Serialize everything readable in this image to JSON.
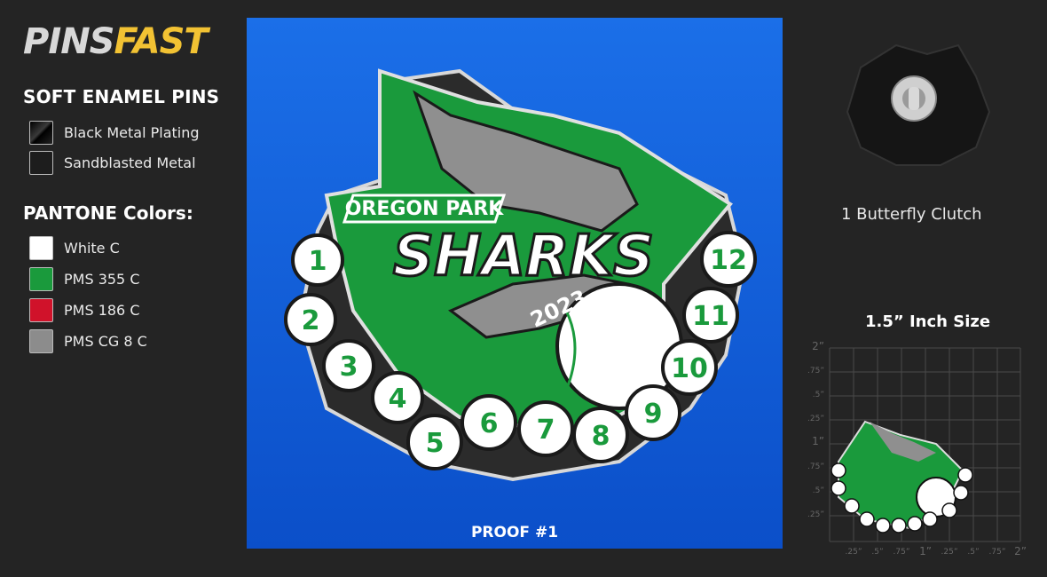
{
  "brand": {
    "part1": "PINS",
    "part2": "FAST"
  },
  "title": "SOFT ENAMEL PINS",
  "finishes": [
    {
      "label": "Black Metal Plating",
      "color": "#111111"
    },
    {
      "label": "Sandblasted Metal",
      "color": "#1d1d1d"
    }
  ],
  "pantone_title": "PANTONE Colors:",
  "pantone": [
    {
      "label": "White C",
      "color": "#ffffff"
    },
    {
      "label": "PMS 355 C",
      "color": "#1a9a3c"
    },
    {
      "label": "PMS 186 C",
      "color": "#d0122a"
    },
    {
      "label": "PMS CG 8 C",
      "color": "#8c8c8c"
    }
  ],
  "pin": {
    "team_top": "OREGON PARK",
    "team_main": "SHARKS",
    "year": "2023",
    "numbers": [
      "1",
      "2",
      "3",
      "4",
      "5",
      "6",
      "7",
      "8",
      "9",
      "10",
      "11",
      "12"
    ]
  },
  "proof_label": "PROOF #1",
  "clutch_label": "1 Butterfly Clutch",
  "size_label": "1.5” Inch Size",
  "ruler": {
    "y_labels": [
      "2”",
      ".75”",
      ".5”",
      ".25”",
      "1”",
      ".75”",
      ".5”",
      ".25”"
    ],
    "x_labels": [
      ".25”",
      ".5”",
      ".75”",
      "1”",
      ".25”",
      ".5”",
      ".75”",
      "2”"
    ]
  }
}
